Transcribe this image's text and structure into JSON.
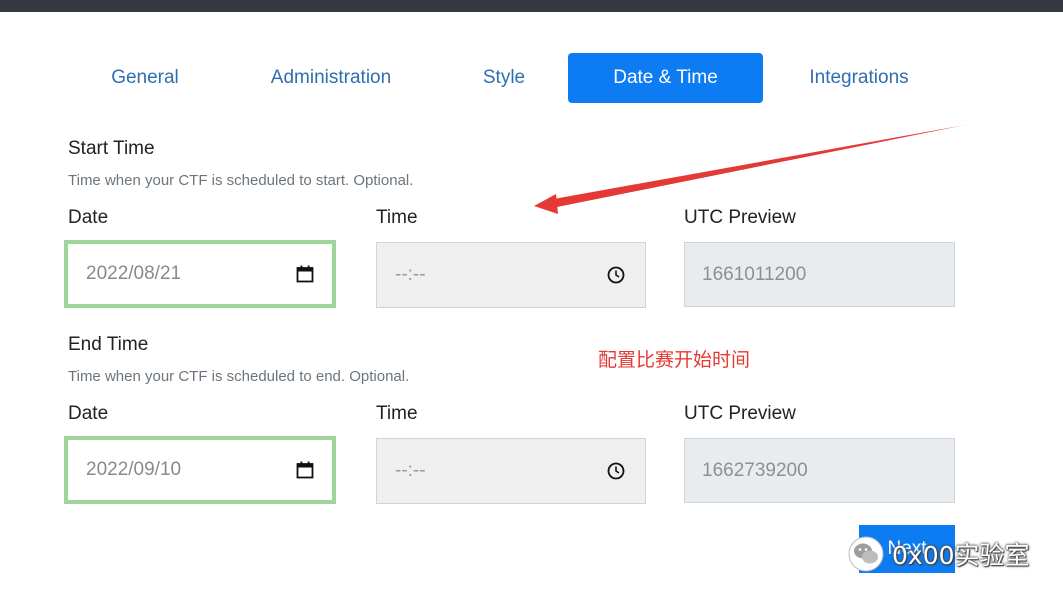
{
  "tabs": [
    {
      "label": "General"
    },
    {
      "label": "Administration"
    },
    {
      "label": "Style"
    },
    {
      "label": "Date & Time",
      "active": true
    },
    {
      "label": "Integrations"
    }
  ],
  "start": {
    "title": "Start Time",
    "help": "Time when your CTF is scheduled to start. Optional.",
    "date_label": "Date",
    "date_value": "2022/08/21",
    "time_label": "Time",
    "time_value": "--:--",
    "utc_label": "UTC Preview",
    "utc_value": "1661011200"
  },
  "end": {
    "title": "End Time",
    "help": "Time when your CTF is scheduled to end. Optional.",
    "date_label": "Date",
    "date_value": "2022/09/10",
    "time_label": "Time",
    "time_value": "--:--",
    "utc_label": "UTC Preview",
    "utc_value": "1662739200"
  },
  "annotation": "配置比赛开始时间",
  "next_label": "Next",
  "watermark": "0x00实验室",
  "colors": {
    "accent": "#0d7bf2",
    "tab_text": "#2f6fb1",
    "highlight_border": "#9fd49b",
    "annotation": "#e53935"
  },
  "icons": {
    "date": "calendar-icon",
    "time": "clock-icon",
    "watermark": "wechat-logo"
  }
}
